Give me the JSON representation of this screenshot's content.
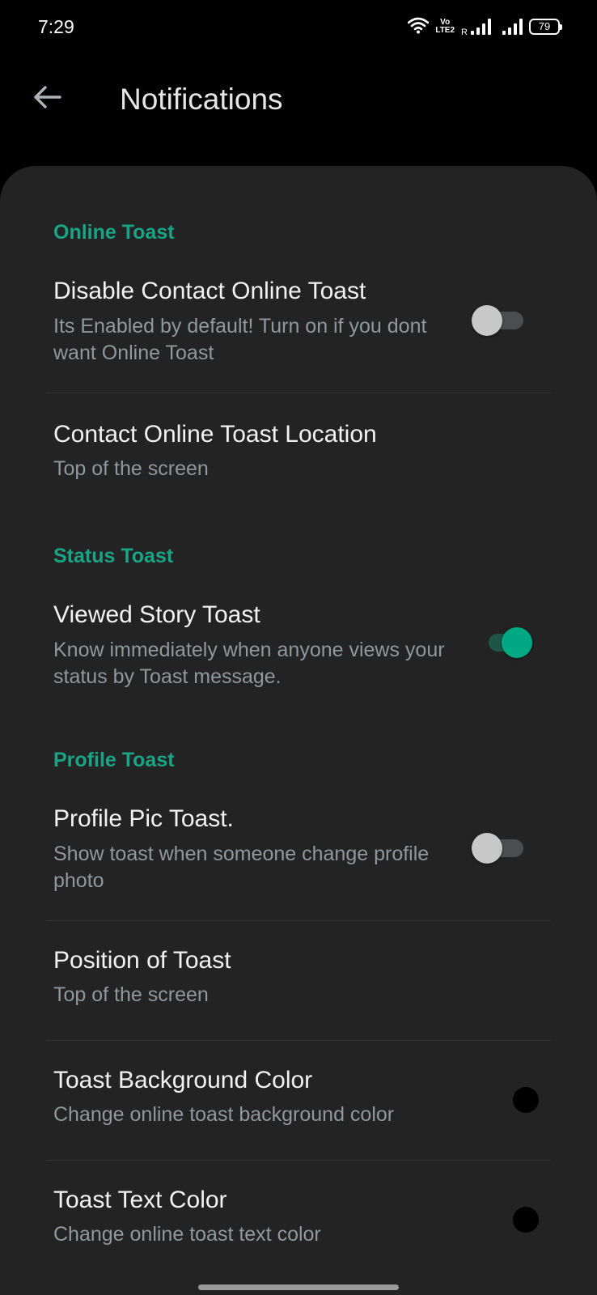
{
  "status_bar": {
    "time": "7:29",
    "volte_top": "Vo",
    "volte_bottom": "LTE2",
    "roaming": "R",
    "battery": "79"
  },
  "app_bar": {
    "back_icon": "arrow-left-icon",
    "title": "Notifications"
  },
  "sections": {
    "online": {
      "header": "Online Toast",
      "disable_online": {
        "title": "Disable Contact Online Toast",
        "summary": "Its Enabled by default! Turn on if you dont want Online Toast",
        "checked": false
      },
      "location": {
        "title": "Contact Online Toast Location",
        "summary": "Top of the screen"
      }
    },
    "status": {
      "header": "Status Toast",
      "viewed_story": {
        "title": "Viewed Story Toast",
        "summary": "Know immediately when anyone views your status by Toast message.",
        "checked": true
      }
    },
    "profile": {
      "header": "Profile Toast",
      "profile_pic": {
        "title": "Profile Pic Toast.",
        "summary": "Show toast when someone change profile photo",
        "checked": false
      },
      "position": {
        "title": "Position of Toast",
        "summary": "Top of the screen"
      },
      "bg_color": {
        "title": "Toast Background Color",
        "summary": "Change online toast background color",
        "color": "#000000"
      },
      "text_color": {
        "title": "Toast Text Color",
        "summary": "Change online toast text color",
        "color": "#000000"
      }
    }
  },
  "colors": {
    "accent": "#00a884",
    "header_text": "#1aa384",
    "card_bg": "#232323"
  }
}
